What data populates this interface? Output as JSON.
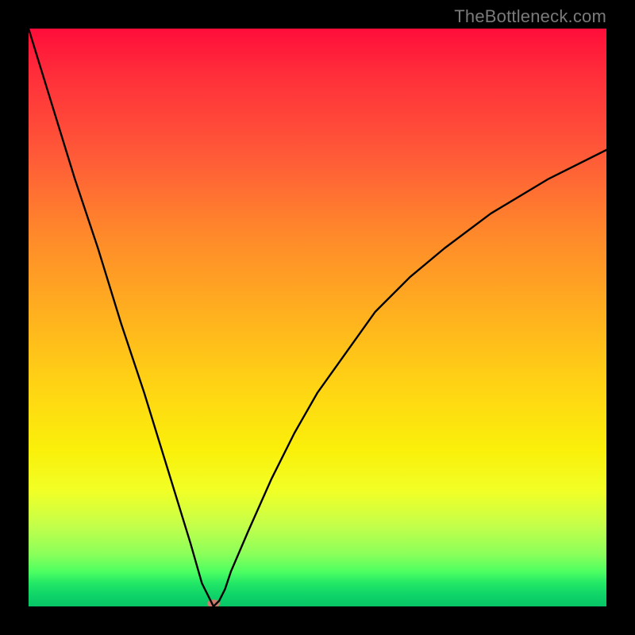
{
  "watermark": {
    "text": "TheBottleneck.com"
  },
  "chart_data": {
    "type": "line",
    "title": "",
    "xlabel": "",
    "ylabel": "",
    "xlim": [
      0,
      100
    ],
    "ylim": [
      0,
      100
    ],
    "grid": false,
    "legend": null,
    "background_gradient": {
      "orientation": "vertical",
      "stops": [
        {
          "pos": 0,
          "color": "#ff0d3a"
        },
        {
          "pos": 22,
          "color": "#ff5a38"
        },
        {
          "pos": 50,
          "color": "#ffb21e"
        },
        {
          "pos": 73,
          "color": "#faf00a"
        },
        {
          "pos": 91,
          "color": "#8aff5a"
        },
        {
          "pos": 100,
          "color": "#07c566"
        }
      ]
    },
    "series": [
      {
        "name": "bottleneck-curve",
        "color": "#000000",
        "x": [
          0,
          4,
          8,
          12,
          16,
          20,
          24,
          28,
          30,
          31,
          32,
          33,
          34,
          35,
          38,
          42,
          46,
          50,
          55,
          60,
          66,
          72,
          80,
          90,
          100
        ],
        "y": [
          100,
          87,
          74,
          62,
          49,
          37,
          24,
          11,
          4,
          2,
          0,
          1,
          3,
          6,
          13,
          22,
          30,
          37,
          44,
          51,
          57,
          62,
          68,
          74,
          79
        ]
      }
    ],
    "marker": {
      "name": "optimal-point",
      "x": 32,
      "y": 0.5,
      "color": "#cf7a6b",
      "rx": 8,
      "ry": 5
    }
  }
}
